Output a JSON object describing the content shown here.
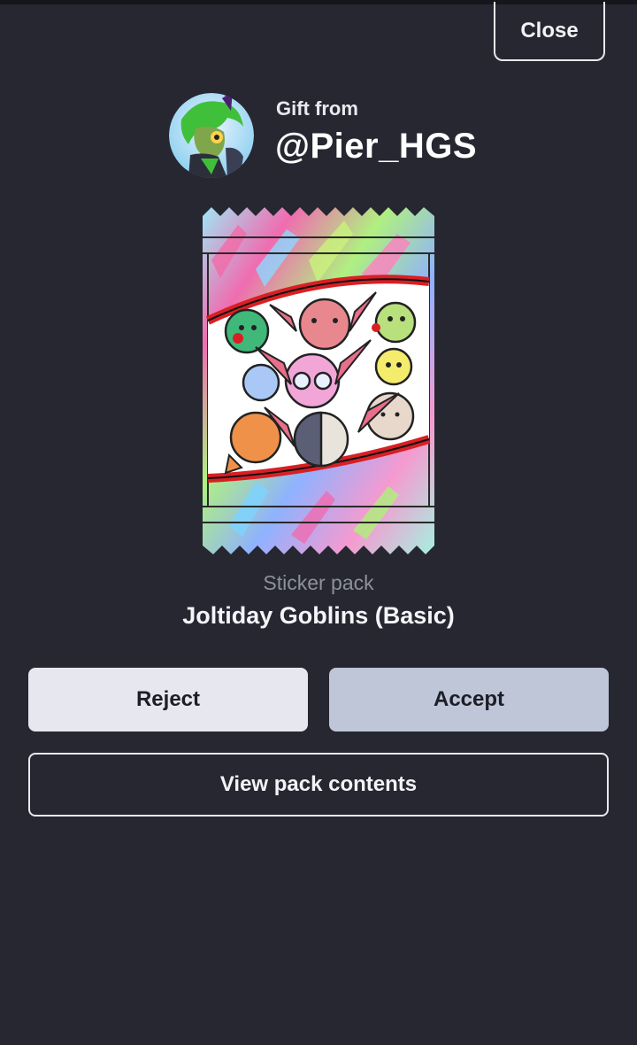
{
  "header": {
    "close_label": "Close"
  },
  "gift": {
    "label": "Gift from",
    "username": "@Pier_HGS"
  },
  "pack": {
    "type": "Sticker pack",
    "name": "Joltiday Goblins (Basic)"
  },
  "actions": {
    "reject_label": "Reject",
    "accept_label": "Accept",
    "view_label": "View pack contents"
  },
  "colors": {
    "background": "#262731",
    "reject_bg": "#e6e7ef",
    "accept_bg": "#bec6d8",
    "pack_red": "#e02424"
  }
}
